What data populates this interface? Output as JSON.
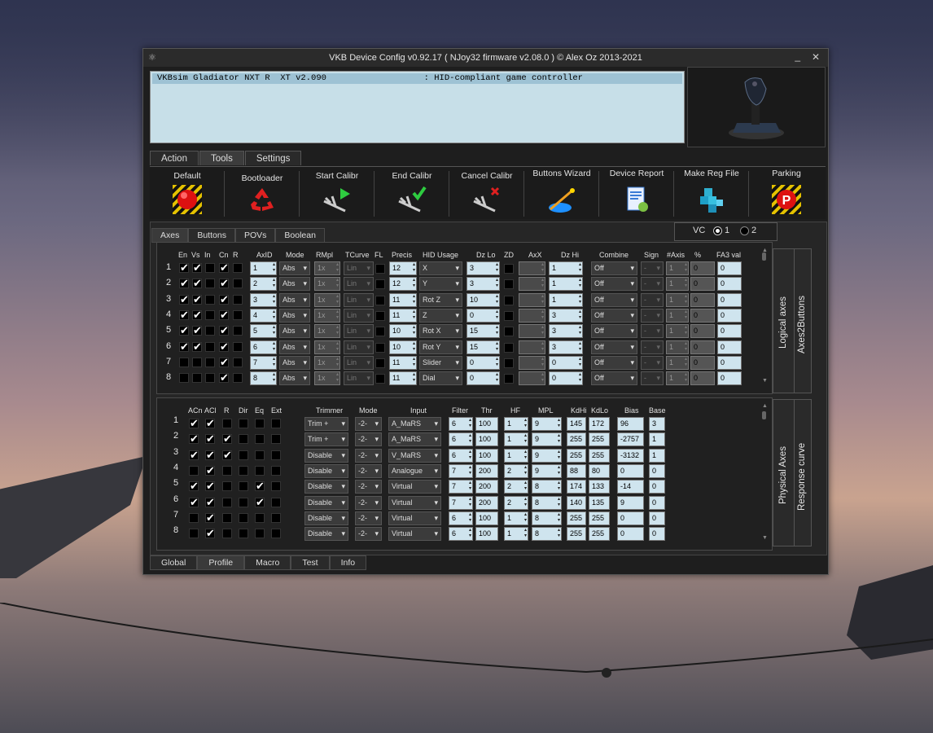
{
  "window": {
    "title": "VKB Device Config v0.92.17 ( NJoy32 firmware v2.08.0 ) © Alex Oz 2013-2021",
    "minimize": "_",
    "close": "✕"
  },
  "device_list": [
    "VKBsim Gladiator NXT R  XT v2.090                   : HID-compliant game controller"
  ],
  "main_tabs": [
    "Action",
    "Tools",
    "Settings"
  ],
  "toolbar": [
    "Default",
    "Bootloader",
    "Start Calibr",
    "End Calibr",
    "Cancel Calibr",
    "Buttons Wizard",
    "Device Report",
    "Make Reg File",
    "Parking"
  ],
  "sub_tabs": [
    "Axes",
    "Buttons",
    "POVs",
    "Boolean"
  ],
  "vc": {
    "label": "VC",
    "opt1": "1",
    "opt2": "2"
  },
  "logical": {
    "side_labels": [
      "Logical axes",
      "Axes2Buttons"
    ],
    "headers": [
      "En",
      "Vs",
      "In",
      "Cn",
      "R",
      "AxID",
      "Mode",
      "RMpl",
      "TCurve",
      "FL",
      "Precis",
      "HID Usage",
      "Dz Lo",
      "ZD",
      "AxX",
      "Dz Hi",
      "Combine",
      "Sign",
      "#Axis",
      "%",
      "FA3 val"
    ],
    "rows": [
      {
        "n": "1",
        "chk": [
          1,
          1,
          0,
          1,
          0
        ],
        "axid": "1",
        "mode": "Abs",
        "rmpl": "1x",
        "tcurve": "Lin",
        "precis": "12",
        "hid": "X",
        "dzlo": "3",
        "dzhi": "1",
        "combine": "Off",
        "sign": "-",
        "axis": "1",
        "pct": "0",
        "fa3": "0"
      },
      {
        "n": "2",
        "chk": [
          1,
          1,
          0,
          1,
          0
        ],
        "axid": "2",
        "mode": "Abs",
        "rmpl": "1x",
        "tcurve": "Lin",
        "precis": "12",
        "hid": "Y",
        "dzlo": "3",
        "dzhi": "1",
        "combine": "Off",
        "sign": "-",
        "axis": "1",
        "pct": "0",
        "fa3": "0"
      },
      {
        "n": "3",
        "chk": [
          1,
          1,
          0,
          1,
          0
        ],
        "axid": "3",
        "mode": "Abs",
        "rmpl": "1x",
        "tcurve": "Lin",
        "precis": "11",
        "hid": "Rot Z",
        "dzlo": "10",
        "dzhi": "1",
        "combine": "Off",
        "sign": "-",
        "axis": "1",
        "pct": "0",
        "fa3": "0"
      },
      {
        "n": "4",
        "chk": [
          1,
          1,
          0,
          1,
          0
        ],
        "axid": "4",
        "mode": "Abs",
        "rmpl": "1x",
        "tcurve": "Lin",
        "precis": "11",
        "hid": "Z",
        "dzlo": "0",
        "dzhi": "3",
        "combine": "Off",
        "sign": "-",
        "axis": "1",
        "pct": "0",
        "fa3": "0"
      },
      {
        "n": "5",
        "chk": [
          1,
          1,
          0,
          1,
          0
        ],
        "axid": "5",
        "mode": "Abs",
        "rmpl": "1x",
        "tcurve": "Lin",
        "precis": "10",
        "hid": "Rot X",
        "dzlo": "15",
        "dzhi": "3",
        "combine": "Off",
        "sign": "-",
        "axis": "1",
        "pct": "0",
        "fa3": "0"
      },
      {
        "n": "6",
        "chk": [
          1,
          1,
          0,
          1,
          0
        ],
        "axid": "6",
        "mode": "Abs",
        "rmpl": "1x",
        "tcurve": "Lin",
        "precis": "10",
        "hid": "Rot Y",
        "dzlo": "15",
        "dzhi": "3",
        "combine": "Off",
        "sign": "-",
        "axis": "1",
        "pct": "0",
        "fa3": "0"
      },
      {
        "n": "7",
        "chk": [
          0,
          0,
          0,
          1,
          0
        ],
        "axid": "7",
        "mode": "Abs",
        "rmpl": "1x",
        "tcurve": "Lin",
        "precis": "11",
        "hid": "Slider",
        "dzlo": "0",
        "dzhi": "0",
        "combine": "Off",
        "sign": "-",
        "axis": "1",
        "pct": "0",
        "fa3": "0"
      },
      {
        "n": "8",
        "chk": [
          0,
          0,
          0,
          1,
          0
        ],
        "axid": "8",
        "mode": "Abs",
        "rmpl": "1x",
        "tcurve": "Lin",
        "precis": "11",
        "hid": "Dial",
        "dzlo": "0",
        "dzhi": "0",
        "combine": "Off",
        "sign": "-",
        "axis": "1",
        "pct": "0",
        "fa3": "0"
      }
    ]
  },
  "physical": {
    "side_labels": [
      "Physical Axes",
      "Response curve"
    ],
    "headers": [
      "ACn",
      "ACl",
      "R",
      "Dir",
      "Eq",
      "Ext",
      "Trimmer",
      "Mode",
      "Input",
      "Filter",
      "Thr",
      "HF",
      "MPL",
      "KdHi",
      "KdLo",
      "Bias",
      "Base"
    ],
    "rows": [
      {
        "n": "1",
        "chk": [
          1,
          1,
          0,
          0,
          0,
          0
        ],
        "trim": "Trim +",
        "mode": "-2-",
        "input": "A_MaRS",
        "filter": "6",
        "thr": "100",
        "hf": "1",
        "mpl": "9",
        "kdhi": "145",
        "kdlo": "172",
        "bias": "96",
        "base": "3"
      },
      {
        "n": "2",
        "chk": [
          1,
          1,
          1,
          0,
          0,
          0
        ],
        "trim": "Trim +",
        "mode": "-2-",
        "input": "A_MaRS",
        "filter": "6",
        "thr": "100",
        "hf": "1",
        "mpl": "9",
        "kdhi": "255",
        "kdlo": "255",
        "bias": "-2757",
        "base": "1"
      },
      {
        "n": "3",
        "chk": [
          1,
          1,
          1,
          0,
          0,
          0
        ],
        "trim": "Disable",
        "mode": "-2-",
        "input": "V_MaRS",
        "filter": "6",
        "thr": "100",
        "hf": "1",
        "mpl": "9",
        "kdhi": "255",
        "kdlo": "255",
        "bias": "-3132",
        "base": "1"
      },
      {
        "n": "4",
        "chk": [
          0,
          1,
          0,
          0,
          0,
          0
        ],
        "trim": "Disable",
        "mode": "-2-",
        "input": "Analogue",
        "filter": "7",
        "thr": "200",
        "hf": "2",
        "mpl": "9",
        "kdhi": "88",
        "kdlo": "80",
        "bias": "0",
        "base": "0"
      },
      {
        "n": "5",
        "chk": [
          1,
          1,
          0,
          0,
          1,
          0
        ],
        "trim": "Disable",
        "mode": "-2-",
        "input": "Virtual",
        "filter": "7",
        "thr": "200",
        "hf": "2",
        "mpl": "8",
        "kdhi": "174",
        "kdlo": "133",
        "bias": "-14",
        "base": "0"
      },
      {
        "n": "6",
        "chk": [
          1,
          1,
          0,
          0,
          1,
          0
        ],
        "trim": "Disable",
        "mode": "-2-",
        "input": "Virtual",
        "filter": "7",
        "thr": "200",
        "hf": "2",
        "mpl": "8",
        "kdhi": "140",
        "kdlo": "135",
        "bias": "9",
        "base": "0"
      },
      {
        "n": "7",
        "chk": [
          0,
          1,
          0,
          0,
          0,
          0
        ],
        "trim": "Disable",
        "mode": "-2-",
        "input": "Virtual",
        "filter": "6",
        "thr": "100",
        "hf": "1",
        "mpl": "8",
        "kdhi": "255",
        "kdlo": "255",
        "bias": "0",
        "base": "0"
      },
      {
        "n": "8",
        "chk": [
          0,
          1,
          0,
          0,
          0,
          0
        ],
        "trim": "Disable",
        "mode": "-2-",
        "input": "Virtual",
        "filter": "6",
        "thr": "100",
        "hf": "1",
        "mpl": "8",
        "kdhi": "255",
        "kdlo": "255",
        "bias": "0",
        "base": "0"
      }
    ]
  },
  "bottom_tabs": [
    "Global",
    "Profile",
    "Macro",
    "Test",
    "Info"
  ]
}
